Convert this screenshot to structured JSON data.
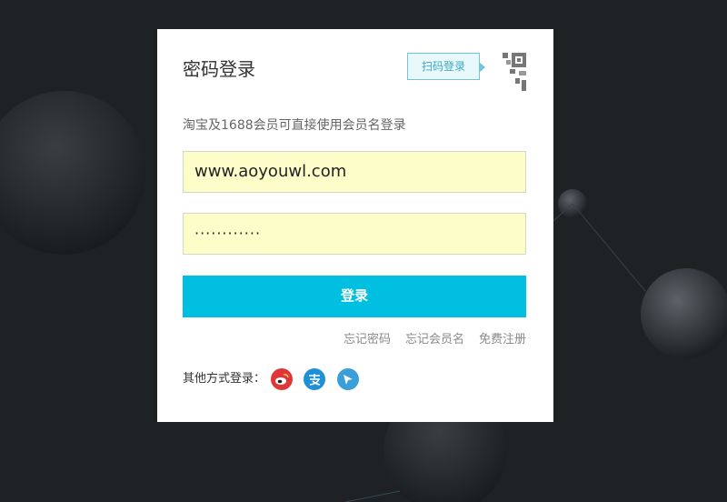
{
  "login": {
    "title": "密码登录",
    "qr_tip": "扫码登录",
    "subtitle": "淘宝及1688会员可直接使用会员名登录",
    "username_value": "www.aoyouwl.com",
    "password_mask": "············",
    "submit_label": "登录",
    "links": [
      "忘记密码",
      "忘记会员名",
      "免费注册"
    ],
    "other_methods_label": "其他方式登录：",
    "social_icons": [
      "weibo-icon",
      "alipay-icon",
      "bird-icon"
    ]
  },
  "colors": {
    "primary": "#00bfe0",
    "input_bg": "#fcfdc8",
    "page_bg": "#1f2225"
  }
}
